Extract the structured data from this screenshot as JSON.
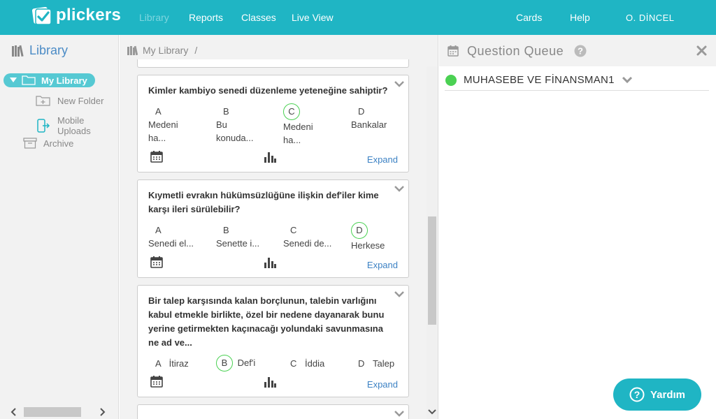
{
  "topbar": {
    "logo_text": "plickers",
    "nav": [
      "Library",
      "Reports",
      "Classes",
      "Live View"
    ],
    "right": [
      "Cards",
      "Help"
    ],
    "user": "O. DİNCEL"
  },
  "sidebar": {
    "title": "Library",
    "my_library": "My Library",
    "new_folder": "New Folder",
    "mobile_uploads": "Mobile Uploads",
    "archive": "Archive"
  },
  "breadcrumb": {
    "label": "My Library",
    "separator": "/"
  },
  "cards": [
    {
      "question": "Kimler kambiyo senedi düzenleme yeteneğine sahiptir?",
      "answers": [
        {
          "letter": "A",
          "text": "Medeni ha..."
        },
        {
          "letter": "B",
          "text": "Bu konuda..."
        },
        {
          "letter": "C",
          "text": "Medeni ha...",
          "correct": true
        },
        {
          "letter": "D",
          "text": "Bankalar"
        }
      ],
      "expand": "Expand"
    },
    {
      "question": "Kıymetli evrakın hükümsüzlüğüne ilişkin def'iler kime karşı ileri sürülebilir?",
      "answers": [
        {
          "letter": "A",
          "text": "Senedi el..."
        },
        {
          "letter": "B",
          "text": "Senette i..."
        },
        {
          "letter": "C",
          "text": "Senedi de..."
        },
        {
          "letter": "D",
          "text": "Herkese",
          "correct": true
        }
      ],
      "expand": "Expand"
    },
    {
      "question": "Bir talep karşısında kalan borçlunun, talebin varlığını kabul etmekle birlikte, özel bir nedene dayanarak bunu yerine getirmekten kaçınacağı yolundaki savunmasına ne ad ve...",
      "answers": [
        {
          "letter": "A",
          "text": "İtiraz"
        },
        {
          "letter": "B",
          "text": "Def'i",
          "correct": true
        },
        {
          "letter": "C",
          "text": "İddia"
        },
        {
          "letter": "D",
          "text": "Talep"
        }
      ],
      "expand": "Expand"
    }
  ],
  "question_queue": {
    "title": "Question Queue",
    "class_name": "MUHASEBE VE FİNANSMAN1"
  },
  "help_button": "Yardım",
  "colors": {
    "brand": "#1fb5c4",
    "correct": "#4bd153",
    "link": "#3d82c4"
  }
}
